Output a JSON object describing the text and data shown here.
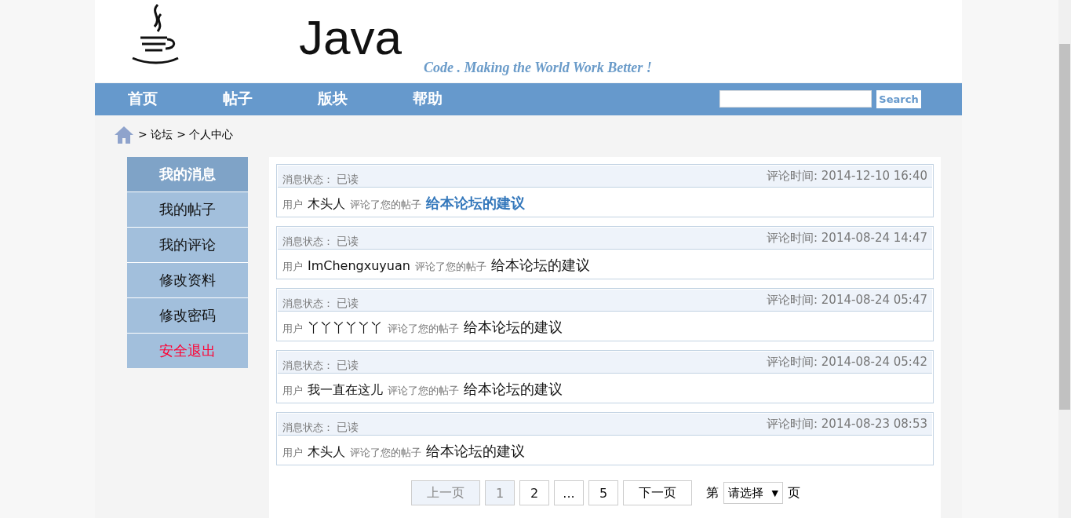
{
  "header": {
    "logo_text": "Java",
    "tagline": "Code . Making the World Work Better !"
  },
  "nav": {
    "items": [
      {
        "label": "首页"
      },
      {
        "label": "帖子"
      },
      {
        "label": "版块"
      },
      {
        "label": "帮助"
      }
    ],
    "search_button": "Search"
  },
  "breadcrumb": [
    "> 论坛",
    "> 个人中心"
  ],
  "sidebar": {
    "items": [
      {
        "label": "我的消息",
        "selected": true,
        "kind": "normal"
      },
      {
        "label": "我的帖子",
        "selected": false,
        "kind": "normal"
      },
      {
        "label": "我的评论",
        "selected": false,
        "kind": "normal"
      },
      {
        "label": "修改资料",
        "selected": false,
        "kind": "normal"
      },
      {
        "label": "修改密码",
        "selected": false,
        "kind": "normal"
      },
      {
        "label": "安全退出",
        "selected": false,
        "kind": "exit"
      }
    ]
  },
  "messages": [
    {
      "status_label": "消息状态：",
      "status": "已读",
      "time": "评论时间: 2014-12-10 16:40",
      "user_label": "用户",
      "user": "木头人",
      "action": "评论了您的帖子",
      "post": "给本论坛的建议",
      "highlighted": true
    },
    {
      "status_label": "消息状态：",
      "status": "已读",
      "time": "评论时间: 2014-08-24 14:47",
      "user_label": "用户",
      "user": "ImChengxuyuan",
      "action": "评论了您的帖子",
      "post": "给本论坛的建议",
      "highlighted": false
    },
    {
      "status_label": "消息状态：",
      "status": "已读",
      "time": "评论时间: 2014-08-24 05:47",
      "user_label": "用户",
      "user": "丫丫丫丫丫丫",
      "action": "评论了您的帖子",
      "post": "给本论坛的建议",
      "highlighted": false
    },
    {
      "status_label": "消息状态：",
      "status": "已读",
      "time": "评论时间: 2014-08-24 05:42",
      "user_label": "用户",
      "user": "我一直在这儿",
      "action": "评论了您的帖子",
      "post": "给本论坛的建议",
      "highlighted": false
    },
    {
      "status_label": "消息状态：",
      "status": "已读",
      "time": "评论时间: 2014-08-23 08:53",
      "user_label": "用户",
      "user": "木头人",
      "action": "评论了您的帖子",
      "post": "给本论坛的建议",
      "highlighted": false
    }
  ],
  "pagination": {
    "prev": {
      "label": "上一页",
      "disabled": true
    },
    "pages": [
      {
        "label": "1",
        "selected": true
      },
      {
        "label": "2",
        "selected": false
      },
      {
        "label": "...",
        "selected": false
      },
      {
        "label": "5",
        "selected": false
      }
    ],
    "next": {
      "label": "下一页",
      "disabled": false
    },
    "jump_prefix": "第",
    "jump_select": "请选择",
    "jump_arrow": "▼",
    "jump_suffix": "页"
  }
}
